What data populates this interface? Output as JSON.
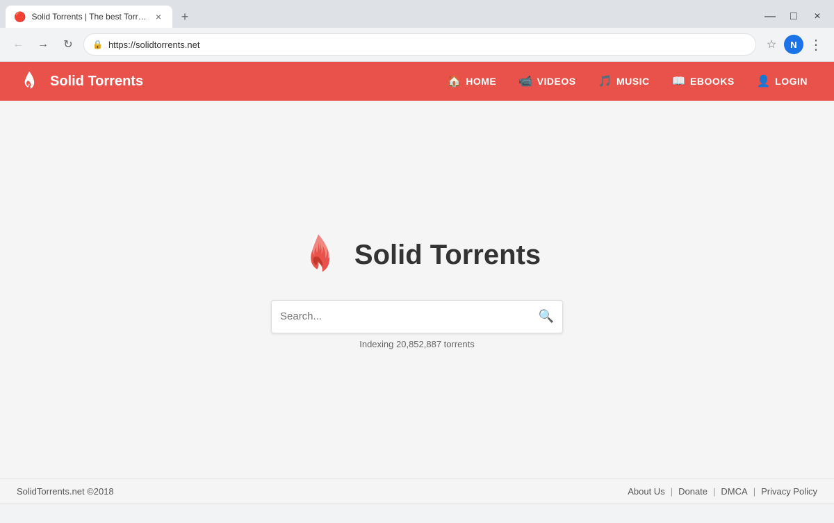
{
  "browser": {
    "tab": {
      "favicon": "🔴",
      "title": "Solid Torrents | The best Torrent",
      "close_label": "×"
    },
    "new_tab_label": "+",
    "window_controls": {
      "minimize": "—",
      "maximize": "□",
      "close": "×"
    },
    "address_bar": {
      "url": "https://solidtorrents.net",
      "lock_icon": "🔒"
    },
    "profile_initial": "N"
  },
  "site": {
    "navbar": {
      "logo_text": "Solid Torrents",
      "nav_items": [
        {
          "label": "HOME",
          "icon": "🏠"
        },
        {
          "label": "VIDEOS",
          "icon": "📹"
        },
        {
          "label": "MUSIC",
          "icon": "🎵"
        },
        {
          "label": "EBOOKS",
          "icon": "📖"
        },
        {
          "label": "LOGIN",
          "icon": "👤"
        }
      ]
    },
    "center": {
      "logo_text": "Solid Torrents",
      "search_placeholder": "Search...",
      "search_button_label": "Search",
      "index_text": "Indexing 20,852,887 torrents"
    },
    "footer": {
      "copyright": "SolidTorrents.net ©2018",
      "links": [
        {
          "label": "About Us"
        },
        {
          "label": "Donate"
        },
        {
          "label": "DMCA"
        },
        {
          "label": "Privacy Policy"
        }
      ]
    }
  }
}
